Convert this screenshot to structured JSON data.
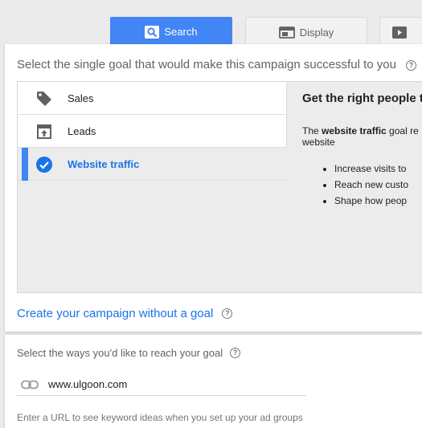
{
  "tabs": [
    {
      "label": "Search",
      "icon": "search-icon",
      "active": true
    },
    {
      "label": "Display",
      "icon": "display-icon",
      "active": false
    },
    {
      "label": "",
      "icon": "video-icon",
      "active": false
    }
  ],
  "goal_section": {
    "heading": "Select the single goal that would make this campaign successful to you",
    "help_icon": "help-icon",
    "goals": [
      {
        "label": "Sales",
        "icon": "tag-icon",
        "selected": false
      },
      {
        "label": "Leads",
        "icon": "leads-icon",
        "selected": false
      },
      {
        "label": "Website traffic",
        "icon": "check-circle-icon",
        "selected": true
      }
    ],
    "description": {
      "title": "Get the right people t",
      "text_before": "The ",
      "text_bold": "website traffic",
      "text_after": " goal re",
      "text_line2": "website",
      "bullets": [
        "Increase visits to",
        "Reach new custo",
        "Shape how peop"
      ]
    },
    "no_goal_link": "Create your campaign without a goal"
  },
  "reach_section": {
    "heading": "Select the ways you'd like to reach your goal",
    "url_icon": "link-icon",
    "url_value": "www.ulgoon.com",
    "url_hint": "Enter a URL to see keyword ideas when you set up your ad groups"
  },
  "colors": {
    "accent": "#4285f4",
    "link": "#1a73e8",
    "panel_bg": "#ececec"
  }
}
